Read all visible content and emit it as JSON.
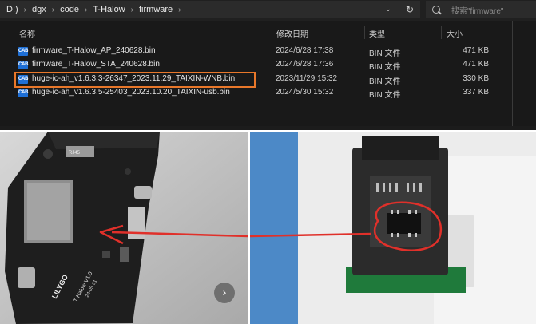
{
  "address": {
    "crumbs": [
      "D:)",
      "dgx",
      "code",
      "T-Halow",
      "firmware"
    ],
    "search_placeholder": "搜索\"firmware\""
  },
  "columns": {
    "name": "名称",
    "modified": "修改日期",
    "type": "类型",
    "size": "大小"
  },
  "files": [
    {
      "name": "firmware_T-Halow_AP_240628.bin",
      "modified": "2024/6/28 17:38",
      "type": "BIN 文件",
      "size": "471 KB",
      "icon": "CAB"
    },
    {
      "name": "firmware_T-Halow_STA_240628.bin",
      "modified": "2024/6/28 17:36",
      "type": "BIN 文件",
      "size": "471 KB",
      "icon": "CAB"
    },
    {
      "name": "huge-ic-ah_v1.6.3.3-26347_2023.11.29_TAIXIN-WNB.bin",
      "modified": "2023/11/29 15:32",
      "type": "BIN 文件",
      "size": "330 KB",
      "icon": "CAB"
    },
    {
      "name": "huge-ic-ah_v1.6.3.5-25403_2023.10.20_TAIXIN-usb.bin",
      "modified": "2024/5/30 15:32",
      "type": "BIN 文件",
      "size": "337 KB",
      "icon": "CAB"
    }
  ],
  "photo": {
    "board_brand": "LILYGO",
    "board_model": "T-Halow V1.0",
    "board_date": "24-05-31",
    "board_rj45": "RJ45",
    "accent": "#e8772a",
    "arrow_color": "#e0302a"
  }
}
